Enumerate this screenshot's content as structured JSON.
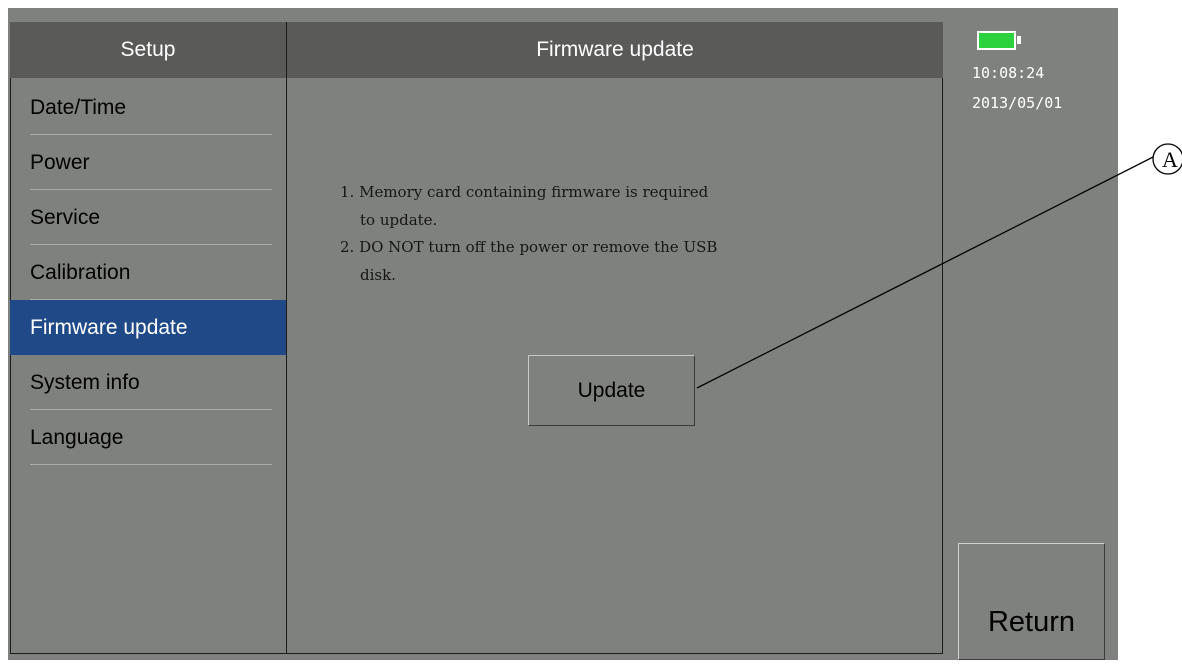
{
  "sidebar": {
    "title": "Setup",
    "items": [
      {
        "label": "Date/Time"
      },
      {
        "label": "Power"
      },
      {
        "label": "Service"
      },
      {
        "label": "Calibration"
      },
      {
        "label": "Firmware update",
        "active": true
      },
      {
        "label": "System info"
      },
      {
        "label": "Language"
      }
    ]
  },
  "main": {
    "title": "Firmware update",
    "instructions": [
      "1. Memory card containing firmware is required",
      "to update.",
      "2. DO NOT turn off the power or remove the USB",
      "disk."
    ],
    "update_button": "Update"
  },
  "status": {
    "battery_icon": "battery-full-icon",
    "battery_color": "#2bd23d",
    "time": "10:08:24",
    "date": "2013/05/01"
  },
  "return_button": "Return",
  "callout_label": "A",
  "colors": {
    "header_bg": "#5a5b59",
    "panel_bg": "#7f817e",
    "active_bg": "#1f4a87"
  }
}
